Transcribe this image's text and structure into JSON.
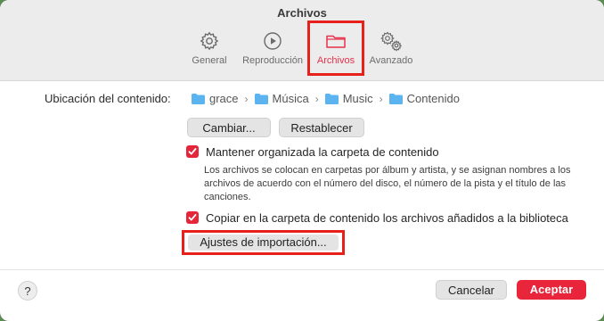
{
  "window": {
    "title": "Archivos"
  },
  "tabs": [
    {
      "label": "General",
      "icon": "gear-icon",
      "active": false
    },
    {
      "label": "Reproducción",
      "icon": "play-circle-icon",
      "active": false
    },
    {
      "label": "Archivos",
      "icon": "folder-icon",
      "active": true
    },
    {
      "label": "Avanzado",
      "icon": "gears-icon",
      "active": false
    }
  ],
  "location": {
    "label": "Ubicación del contenido:",
    "path": [
      "grace",
      "Música",
      "Music",
      "Contenido"
    ]
  },
  "buttons": {
    "change": "Cambiar...",
    "reset": "Restablecer",
    "import_settings": "Ajustes de importación..."
  },
  "options": {
    "keep_organized": {
      "label": "Mantener organizada la carpeta de contenido",
      "checked": true,
      "description": "Los archivos se colocan en carpetas por álbum y artista, y se asignan nombres a los archivos de acuerdo con el número del disco, el número de la pista y el título de las canciones."
    },
    "copy_files": {
      "label": "Copiar en la carpeta de contenido los archivos añadidos a la biblioteca",
      "checked": true
    }
  },
  "footer": {
    "help": "?",
    "cancel": "Cancelar",
    "accept": "Aceptar"
  },
  "colors": {
    "accent": "#e8253b",
    "folder": "#5bb4f0",
    "highlight_box": "#e8201b"
  }
}
